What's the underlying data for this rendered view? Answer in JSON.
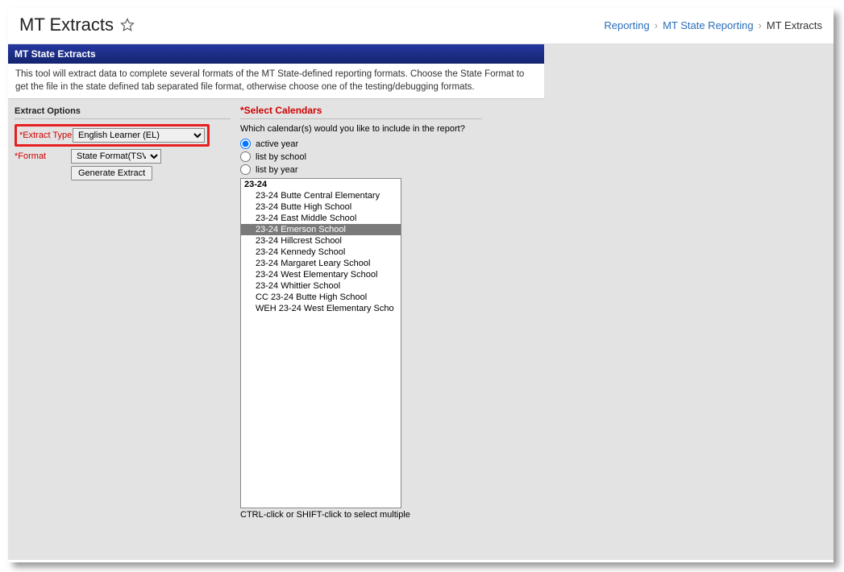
{
  "header": {
    "title": "MT Extracts"
  },
  "breadcrumb": {
    "items": [
      "Reporting",
      "MT State Reporting",
      "MT Extracts"
    ]
  },
  "panel": {
    "title": "MT State Extracts",
    "description": "This tool will extract data to complete several formats of the MT State-defined reporting formats. Choose the State Format to get the file in the state defined tab separated file format, otherwise choose one of the testing/debugging formats."
  },
  "extract": {
    "heading": "Extract Options",
    "type_label": "*Extract Type",
    "type_value": "English Learner (EL)",
    "format_label": "*Format",
    "format_value": "State Format(TSV)",
    "button": "Generate Extract"
  },
  "calendars": {
    "heading": "*Select Calendars",
    "prompt": "Which calendar(s) would you like to include in the report?",
    "radios": [
      "active year",
      "list by school",
      "list by year"
    ],
    "selected_radio": 0,
    "group": "23-24",
    "items": [
      "23-24 Butte Central Elementary",
      "23-24 Butte High School",
      "23-24 East Middle School",
      "23-24 Emerson School",
      "23-24 Hillcrest School",
      "23-24 Kennedy School",
      "23-24 Margaret Leary School",
      "23-24 West Elementary School",
      "23-24 Whittier School",
      "CC 23-24 Butte High School",
      "WEH 23-24 West Elementary Scho"
    ],
    "selected_item": 3,
    "hint": "CTRL-click or SHIFT-click to select multiple"
  }
}
